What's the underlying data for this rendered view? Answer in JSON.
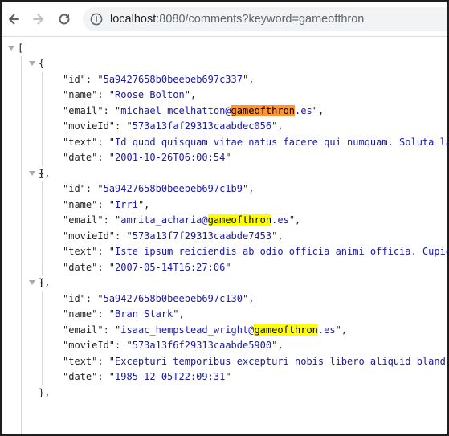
{
  "browser": {
    "url_host": "localhost",
    "url_path": ":8080/comments?keyword=gameofthron"
  },
  "json_view": {
    "open_bracket": "[",
    "open_brace": "{",
    "close_brace": "},",
    "highlight": "gameofthron",
    "records": [
      {
        "id": "5a9427658b0beebeb697c337",
        "name": "Roose Bolton",
        "email_prefix": "michael_mcelhatton@",
        "email_suffix": ".es",
        "movieId": "573a13faf29313caabdec056",
        "text": "Id quod quisquam vitae natus facere qui numquam. Soluta lab",
        "date": "2001-10-26T06:00:54",
        "highlight_color": "#ff9632"
      },
      {
        "id": "5a9427658b0beebeb697c1b9",
        "name": "Irri",
        "email_prefix": "amrita_acharia@",
        "email_suffix": ".es",
        "movieId": "573a13f7f29313caabde7453",
        "text": "Iste ipsum reiciendis ab odio officia animi officia. Cupidi",
        "date": "2007-05-14T16:27:06",
        "highlight_color": "#ffff00"
      },
      {
        "id": "5a9427658b0beebeb697c130",
        "name": "Bran Stark",
        "email_prefix": "isaac_hempstead_wright@",
        "email_suffix": ".es",
        "movieId": "573a13f6f29313caabde5900",
        "text": "Excepturi temporibus excepturi nobis libero aliquid blandit",
        "date": "1985-12-05T22:09:31",
        "highlight_color": "#ffff00"
      }
    ]
  }
}
